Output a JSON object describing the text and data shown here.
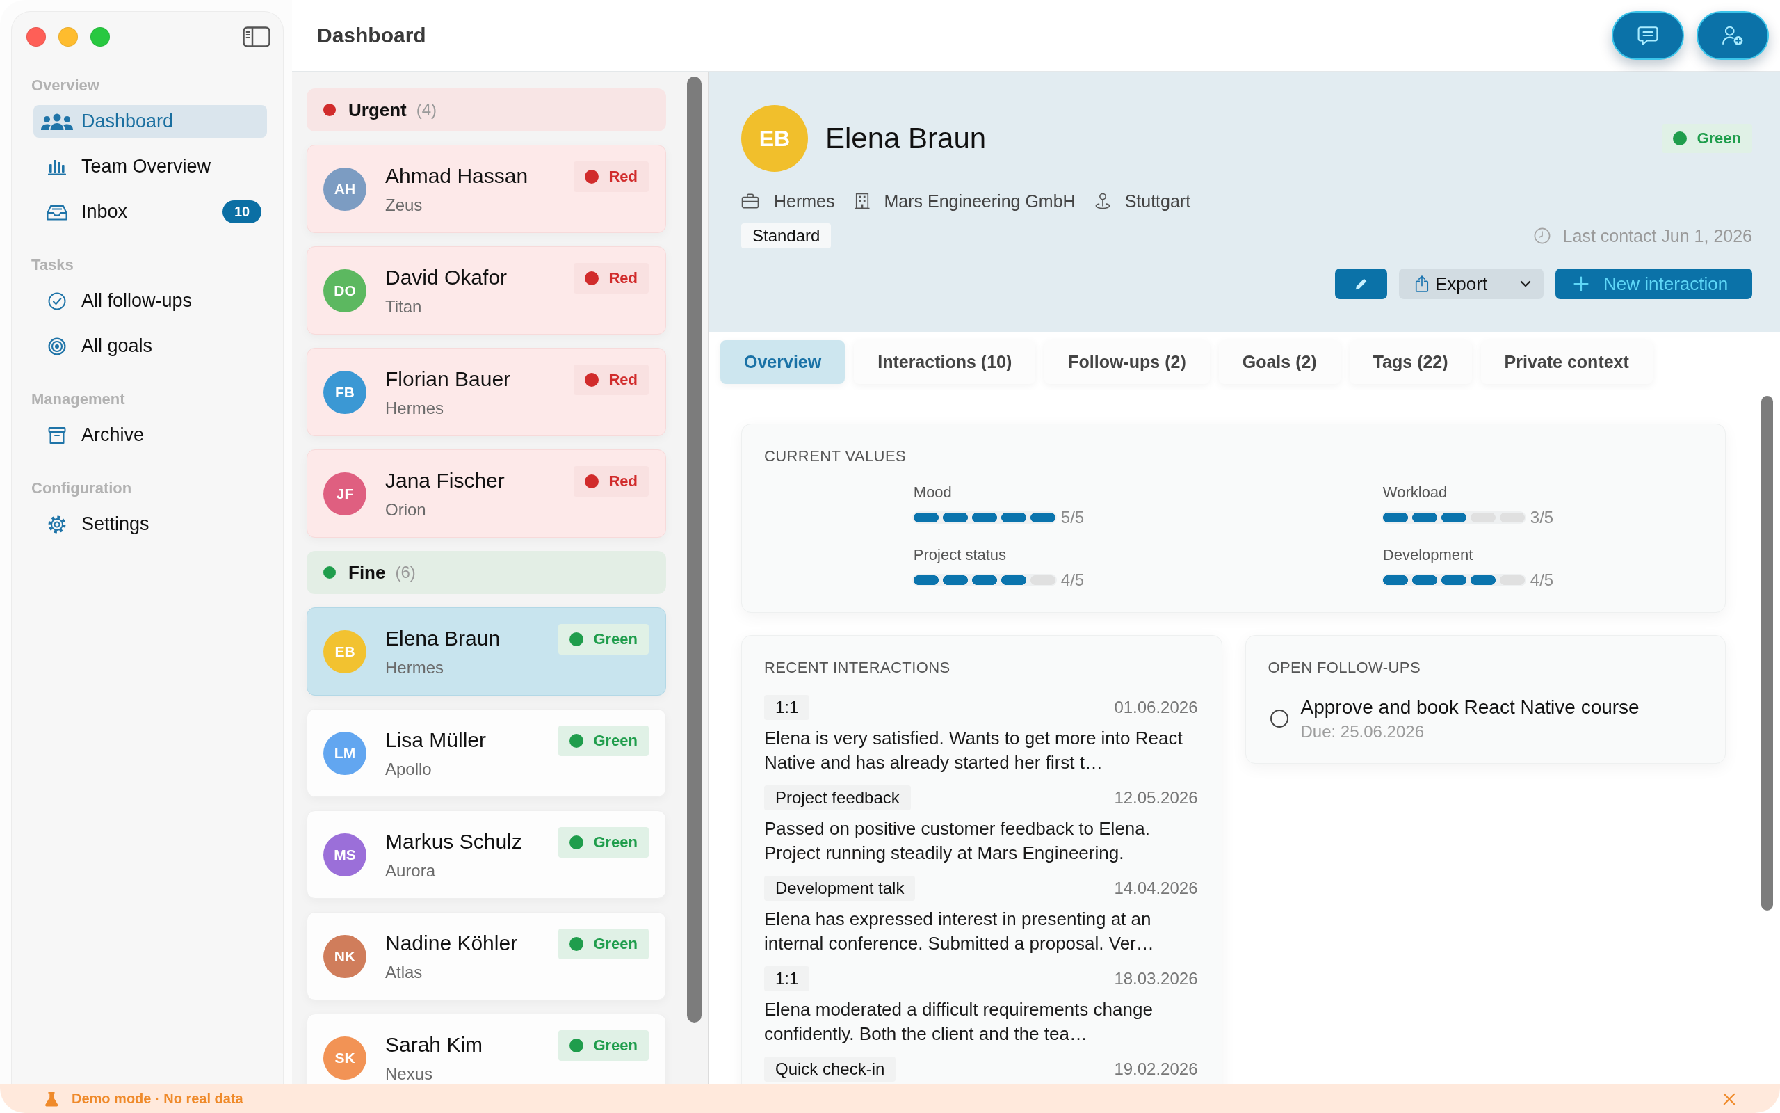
{
  "window": {
    "title": "Dashboard"
  },
  "sidebar": {
    "sections": [
      {
        "label": "Overview",
        "items": [
          {
            "label": "Dashboard",
            "selected": true
          },
          {
            "label": "Team Overview",
            "selected": false
          },
          {
            "label": "Inbox",
            "selected": false,
            "badge": "10"
          }
        ]
      },
      {
        "label": "Tasks",
        "items": [
          {
            "label": "All follow-ups",
            "selected": false
          },
          {
            "label": "All goals",
            "selected": false
          }
        ]
      },
      {
        "label": "Management",
        "items": [
          {
            "label": "Archive",
            "selected": false
          }
        ]
      },
      {
        "label": "Configuration",
        "items": [
          {
            "label": "Settings",
            "selected": false
          }
        ]
      }
    ]
  },
  "people_list": {
    "groups": [
      {
        "kind": "urgent",
        "label": "Urgent",
        "count": "(4)",
        "color": "#d12c2c",
        "people": [
          {
            "initials": "AH",
            "name": "Ahmad Hassan",
            "team": "Zeus",
            "color": "#7c9cc2",
            "status": {
              "label": "Red",
              "color": "#d12c2c"
            },
            "selected": false
          },
          {
            "initials": "DO",
            "name": "David Okafor",
            "team": "Titan",
            "color": "#5cb860",
            "status": {
              "label": "Red",
              "color": "#d12c2c"
            },
            "selected": false
          },
          {
            "initials": "FB",
            "name": "Florian Bauer",
            "team": "Hermes",
            "color": "#3b98d4",
            "status": {
              "label": "Red",
              "color": "#d12c2c"
            },
            "selected": false
          },
          {
            "initials": "JF",
            "name": "Jana Fischer",
            "team": "Orion",
            "color": "#df5f80",
            "status": {
              "label": "Red",
              "color": "#d12c2c"
            },
            "selected": false
          }
        ]
      },
      {
        "kind": "fine",
        "label": "Fine",
        "count": "(6)",
        "color": "#1f9d4c",
        "people": [
          {
            "initials": "EB",
            "name": "Elena Braun",
            "team": "Hermes",
            "color": "#f2c230",
            "status": {
              "label": "Green",
              "color": "#1f9d4c"
            },
            "selected": true
          },
          {
            "initials": "LM",
            "name": "Lisa Müller",
            "team": "Apollo",
            "color": "#62a6f0",
            "status": {
              "label": "Green",
              "color": "#1f9d4c"
            },
            "selected": false
          },
          {
            "initials": "MS",
            "name": "Markus Schulz",
            "team": "Aurora",
            "color": "#9b6fd9",
            "status": {
              "label": "Green",
              "color": "#1f9d4c"
            },
            "selected": false
          },
          {
            "initials": "NK",
            "name": "Nadine Köhler",
            "team": "Atlas",
            "color": "#d07d5b",
            "status": {
              "label": "Green",
              "color": "#1f9d4c"
            },
            "selected": false
          },
          {
            "initials": "SK",
            "name": "Sarah Kim",
            "team": "Nexus",
            "color": "#f29355",
            "status": {
              "label": "Green",
              "color": "#1f9d4c"
            },
            "selected": false
          }
        ]
      }
    ]
  },
  "detail": {
    "avatar": {
      "initials": "EB",
      "color": "#f1bf2c"
    },
    "name": "Elena Braun",
    "status": {
      "label": "Green",
      "color": "#1f9d4c"
    },
    "meta": [
      {
        "kind": "team",
        "text": "Hermes"
      },
      {
        "kind": "company",
        "text": "Mars Engineering GmbH"
      },
      {
        "kind": "location",
        "text": "Stuttgart"
      }
    ],
    "tag": "Standard",
    "last_contact": "Last contact Jun 1, 2026",
    "actions": [
      {
        "kind": "edit"
      },
      {
        "kind": "export",
        "label": "Export"
      },
      {
        "kind": "create",
        "label": "New interaction"
      }
    ],
    "tabs": [
      {
        "label": "Overview",
        "selected": true
      },
      {
        "label": "Interactions (10)",
        "selected": false
      },
      {
        "label": "Follow-ups (2)",
        "selected": false
      },
      {
        "label": "Goals (2)",
        "selected": false
      },
      {
        "label": "Tags (22)",
        "selected": false
      },
      {
        "label": "Private context",
        "selected": false
      }
    ]
  },
  "overview": {
    "current_values": {
      "title": "CURRENT VALUES",
      "metrics": [
        {
          "label": "Mood",
          "level": 1.0,
          "reading": "5/5"
        },
        {
          "label": "Workload",
          "level": 0.6,
          "reading": "3/5"
        },
        {
          "label": "Project status",
          "level": 0.8,
          "reading": "4/5"
        },
        {
          "label": "Development",
          "level": 0.8,
          "reading": "4/5"
        }
      ]
    },
    "recent_interactions": {
      "title": "RECENT INTERACTIONS",
      "items": [
        {
          "type": "1:1",
          "date": "01.06.2026",
          "text": "Elena is very satisfied. Wants to get more into React Native and has already started her first t…"
        },
        {
          "type": "Project feedback",
          "date": "12.05.2026",
          "text": "Passed on positive customer feedback to Elena. Project running steadily at Mars Engineering."
        },
        {
          "type": "Development talk",
          "date": "14.04.2026",
          "text": "Elena has expressed interest in presenting at an internal conference. Submitted a proposal. Ver…"
        },
        {
          "type": "1:1",
          "date": "18.03.2026",
          "text": "Elena moderated a difficult requirements change confidently. Both the client and the tea…"
        },
        {
          "type": "Quick check-in",
          "date": "19.02.2026"
        }
      ]
    },
    "open_follow_ups": {
      "title": "OPEN FOLLOW-UPS",
      "items": [
        {
          "title": "Approve and book React Native course",
          "due": "Due: 25.06.2026",
          "checked": false
        }
      ]
    }
  },
  "demo_banner": {
    "text": "Demo mode · No real data"
  }
}
